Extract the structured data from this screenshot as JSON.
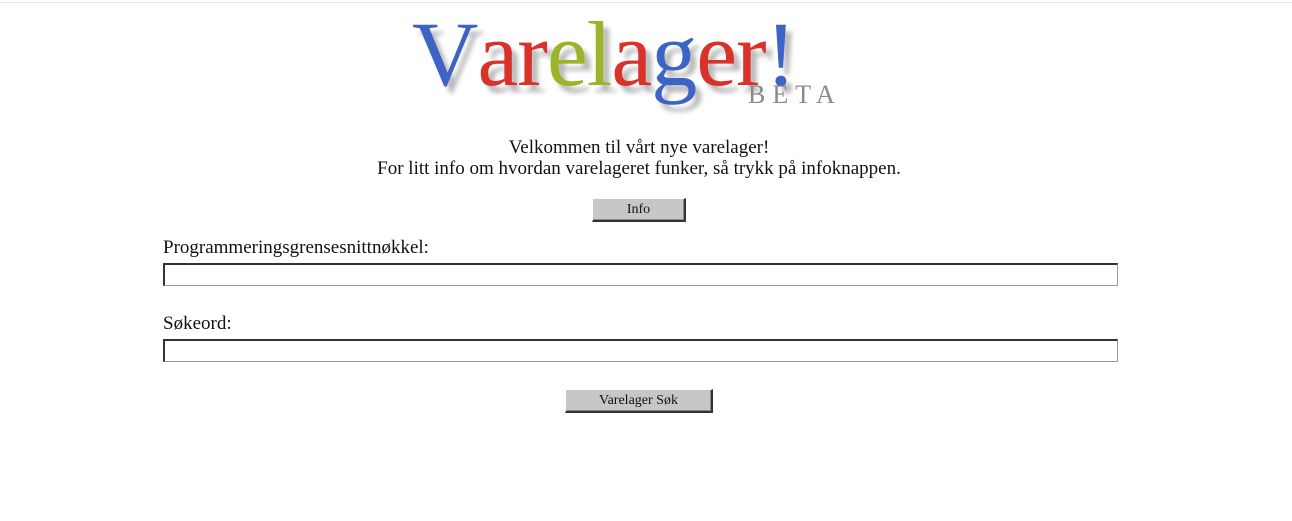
{
  "logo": {
    "letters": [
      {
        "char": "V",
        "color": "#3b64c4"
      },
      {
        "char": "a",
        "color": "#d8322a"
      },
      {
        "char": "r",
        "color": "#d8322a"
      },
      {
        "char": "e",
        "color": "#9ab52a"
      },
      {
        "char": "l",
        "color": "#9ab52a"
      },
      {
        "char": "a",
        "color": "#d8322a"
      },
      {
        "char": "g",
        "color": "#3b64c4"
      },
      {
        "char": "e",
        "color": "#d8322a"
      },
      {
        "char": "r",
        "color": "#d8322a"
      },
      {
        "char": "!",
        "color": "#3b64c4"
      }
    ],
    "subtitle": "BETA",
    "subtitle_color": "#8a8a8a"
  },
  "welcome": {
    "line1": "Velkommen til vårt nye varelager!",
    "line2": "For litt info om hvordan varelageret funker, så trykk på infoknappen."
  },
  "info_button": {
    "label": "Info"
  },
  "api_key": {
    "label": "Programmeringsgrensesnittnøkkel:",
    "value": ""
  },
  "search_term": {
    "label": "Søkeord:",
    "value": ""
  },
  "search_button": {
    "label": "Varelager Søk"
  }
}
